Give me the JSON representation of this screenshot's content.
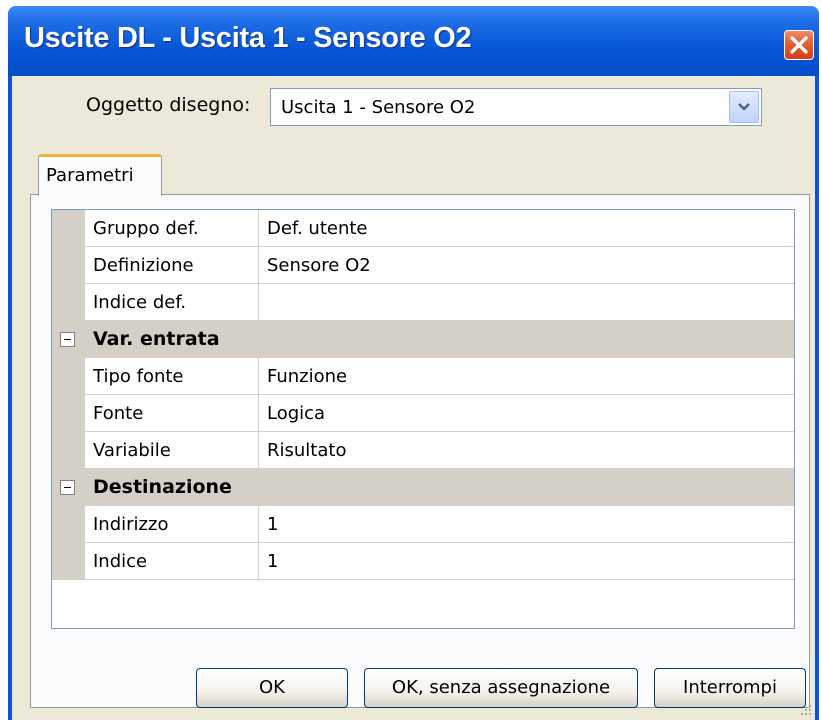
{
  "window": {
    "title": "Uscite DL - Uscita 1 - Sensore O2",
    "close_icon": "close-icon"
  },
  "object_selector": {
    "label": "Oggetto disegno:",
    "value": "Uscita 1 - Sensore O2"
  },
  "tabs": [
    {
      "label": "Parametri",
      "active": true
    }
  ],
  "properties": {
    "rows": [
      {
        "name": "Gruppo def.",
        "value": "Def. utente"
      },
      {
        "name": "Definizione",
        "value": "Sensore O2"
      },
      {
        "name": "Indice def.",
        "value": ""
      }
    ],
    "categories": [
      {
        "label": "Var. entrata",
        "expanded": true,
        "rows": [
          {
            "name": "Tipo fonte",
            "value": "Funzione"
          },
          {
            "name": "Fonte",
            "value": "Logica"
          },
          {
            "name": "Variabile",
            "value": "Risultato"
          }
        ]
      },
      {
        "label": "Destinazione",
        "expanded": true,
        "rows": [
          {
            "name": "Indirizzo",
            "value": "1"
          },
          {
            "name": "Indice",
            "value": "1"
          }
        ]
      }
    ]
  },
  "buttons": {
    "ok": "OK",
    "ok_no_assign": "OK, senza assegnazione",
    "cancel": "Interrompi"
  },
  "colors": {
    "titlebar": "#0a59d8",
    "dialog_bg": "#ece9d8",
    "grid_line": "#d4d0c8",
    "tab_accent": "#f2b33d",
    "close_button": "#e55a2e"
  }
}
